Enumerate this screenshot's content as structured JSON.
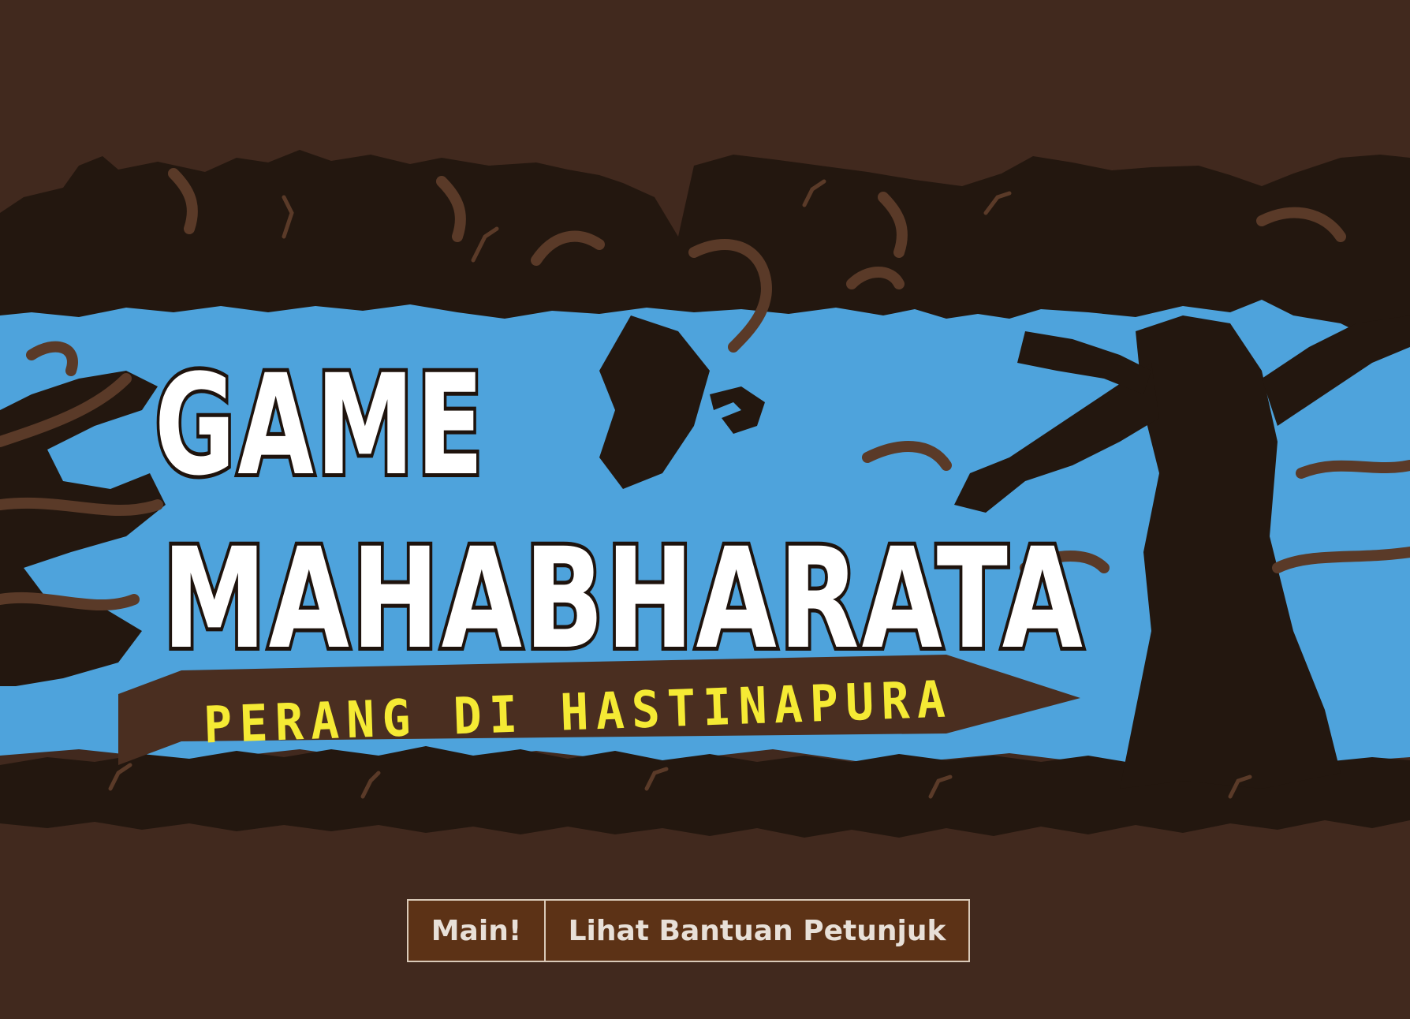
{
  "title": {
    "line1": "GAME",
    "line2": "MAHABHARATA",
    "subtitle": "PERANG DI HASTINAPURA"
  },
  "menu": {
    "play_label": "Main!",
    "help_label": "Lihat Bantuan Petunjuk"
  },
  "colors": {
    "background": "#41291e",
    "sky": "#4ea3dc",
    "silhouette": "#23170f",
    "branch": "#5a3a28",
    "ribbon": "#4a2e20",
    "title": "#ffffff",
    "subtitle": "#f5ea34",
    "button_bg": "#5c3216",
    "button_text": "#e8e0d8",
    "button_border": "#d9c9b8"
  }
}
